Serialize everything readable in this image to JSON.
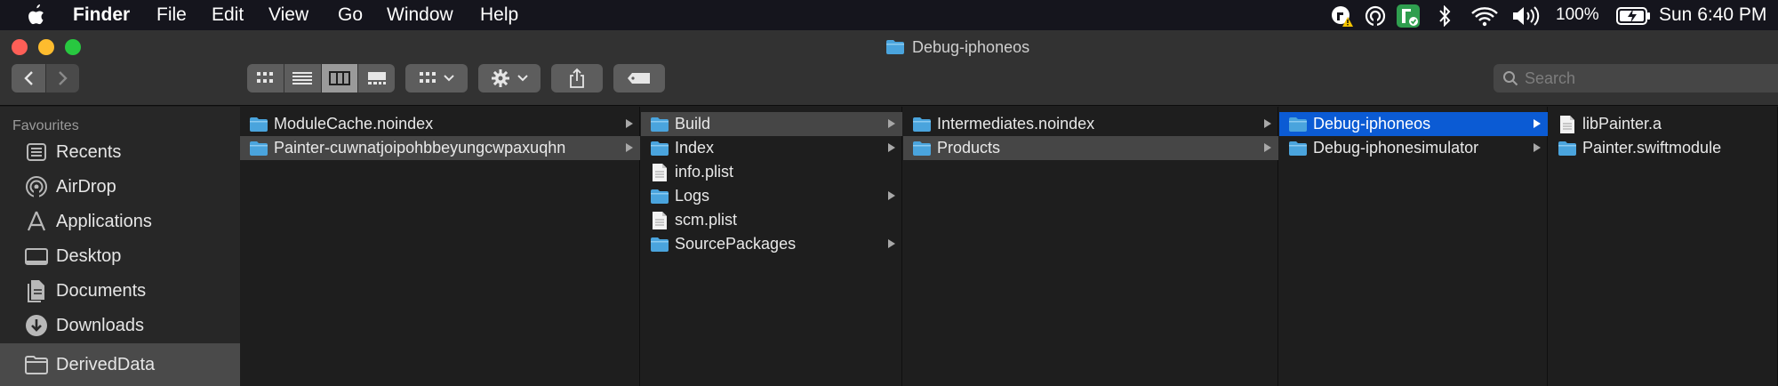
{
  "menubar": {
    "app": "Finder",
    "menus": [
      "File",
      "Edit",
      "View",
      "Go",
      "Window",
      "Help"
    ],
    "battery": "100%",
    "clock": "Sun 6:40 PM"
  },
  "window": {
    "title": "Debug-iphoneos",
    "search_placeholder": "Search",
    "view_mode": "columns"
  },
  "sidebar": {
    "heading": "Favourites",
    "items": [
      {
        "label": "Recents",
        "icon": "recents-icon"
      },
      {
        "label": "AirDrop",
        "icon": "airdrop-icon"
      },
      {
        "label": "Applications",
        "icon": "applications-icon"
      },
      {
        "label": "Desktop",
        "icon": "desktop-icon"
      },
      {
        "label": "Documents",
        "icon": "documents-icon"
      },
      {
        "label": "Downloads",
        "icon": "downloads-icon"
      },
      {
        "label": "DerivedData",
        "icon": "folder-icon",
        "selected": true
      }
    ]
  },
  "columns": [
    {
      "items": [
        {
          "name": "ModuleCache.noindex",
          "kind": "folder",
          "has_children": true
        },
        {
          "name": "Painter-cuwnatjoipohbbeyungcwpaxuqhn",
          "kind": "folder",
          "has_children": true,
          "state": "path"
        }
      ]
    },
    {
      "items": [
        {
          "name": "Build",
          "kind": "folder",
          "has_children": true,
          "state": "path"
        },
        {
          "name": "Index",
          "kind": "folder",
          "has_children": true
        },
        {
          "name": "info.plist",
          "kind": "file",
          "has_children": false
        },
        {
          "name": "Logs",
          "kind": "folder",
          "has_children": true
        },
        {
          "name": "scm.plist",
          "kind": "file",
          "has_children": false
        },
        {
          "name": "SourcePackages",
          "kind": "folder",
          "has_children": true
        }
      ]
    },
    {
      "items": [
        {
          "name": "Intermediates.noindex",
          "kind": "folder",
          "has_children": true
        },
        {
          "name": "Products",
          "kind": "folder",
          "has_children": true,
          "state": "path"
        }
      ]
    },
    {
      "items": [
        {
          "name": "Debug-iphoneos",
          "kind": "folder",
          "has_children": true,
          "state": "selected"
        },
        {
          "name": "Debug-iphonesimulator",
          "kind": "folder",
          "has_children": true
        }
      ]
    },
    {
      "items": [
        {
          "name": "libPainter.a",
          "kind": "file",
          "has_children": false
        },
        {
          "name": "Painter.swiftmodule",
          "kind": "folder",
          "has_children": false
        }
      ]
    }
  ],
  "colors": {
    "selection_blue": "#0b5bd4",
    "path_grey": "#464646",
    "folder_blue": "#4aa4dd",
    "close": "#fe5f57",
    "minimize": "#febc2e",
    "zoom": "#28c840"
  }
}
